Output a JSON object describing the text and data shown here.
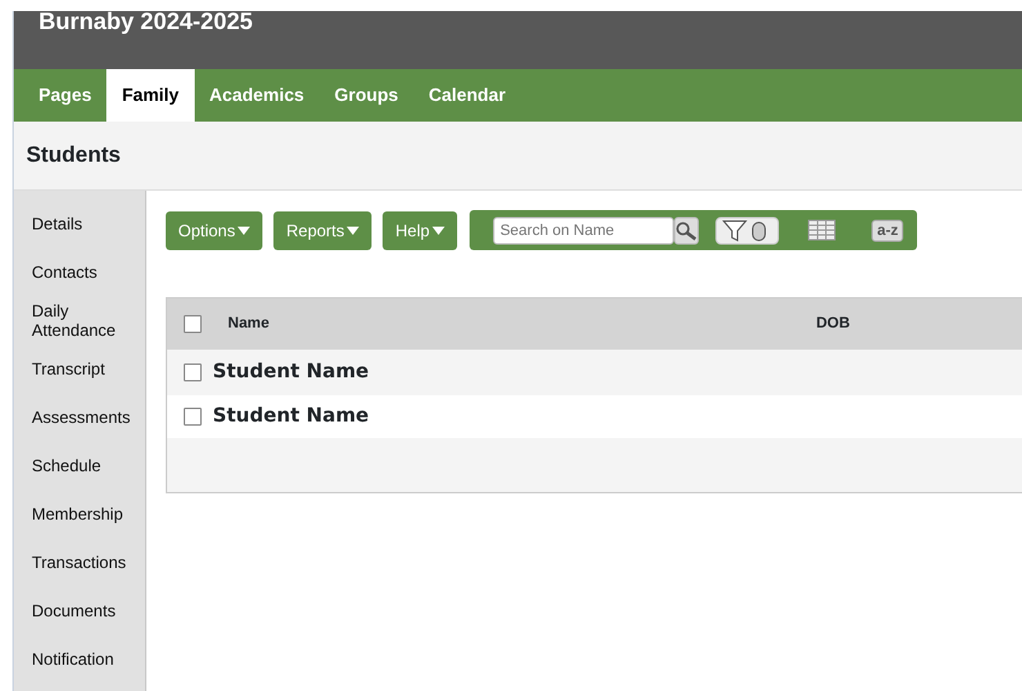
{
  "app": {
    "title": "Burnaby 2024-2025"
  },
  "nav": {
    "tabs": [
      {
        "label": "Pages",
        "selected": false
      },
      {
        "label": "Family",
        "selected": true
      },
      {
        "label": "Academics",
        "selected": false
      },
      {
        "label": "Groups",
        "selected": false
      },
      {
        "label": "Calendar",
        "selected": false
      }
    ]
  },
  "page_title": "Students",
  "sidebar": {
    "items": [
      "Details",
      "Contacts",
      "Daily Attendance",
      "Transcript",
      "Assessments",
      "Schedule",
      "Membership",
      "Transactions",
      "Documents",
      "Notification"
    ]
  },
  "toolbar": {
    "menus": [
      "Options",
      "Reports",
      "Help"
    ],
    "search": {
      "placeholder": "Search on Name"
    },
    "tool_buttons": [
      {
        "kind": "filter",
        "selected": true
      },
      {
        "kind": "grid",
        "selected": false
      },
      {
        "kind": "sort",
        "label": "a-z",
        "selected": false
      }
    ]
  },
  "table": {
    "columns": [
      "Name",
      "DOB"
    ],
    "select_all_checked": false,
    "rows": [
      {
        "name": "Student Name",
        "checked": false
      },
      {
        "name": "Student Name",
        "checked": false
      }
    ]
  }
}
